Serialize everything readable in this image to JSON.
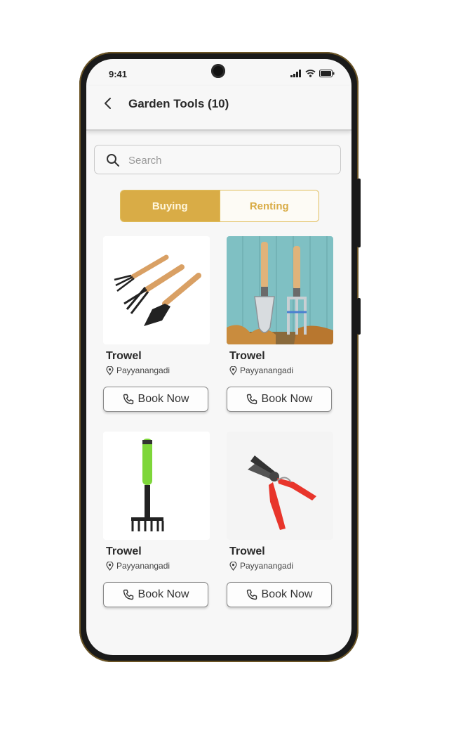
{
  "status": {
    "time": "9:41"
  },
  "header": {
    "title": "Garden Tools (10)"
  },
  "search": {
    "placeholder": "Search"
  },
  "toggle": {
    "buying": "Buying",
    "renting": "Renting",
    "active": "Buying"
  },
  "colors": {
    "accent": "#d9ac46",
    "accent_border": "#e0bd5c"
  },
  "products": [
    {
      "name": "Trowel",
      "location": "Payyanangadi",
      "button": "Book Now",
      "image": "hand-tool-set"
    },
    {
      "name": "Trowel",
      "location": "Payyanangadi",
      "button": "Book Now",
      "image": "trowel-and-fork"
    },
    {
      "name": "Trowel",
      "location": "Payyanangadi",
      "button": "Book Now",
      "image": "hand-rake"
    },
    {
      "name": "Trowel",
      "location": "Payyanangadi",
      "button": "Book Now",
      "image": "pruning-shears"
    }
  ]
}
